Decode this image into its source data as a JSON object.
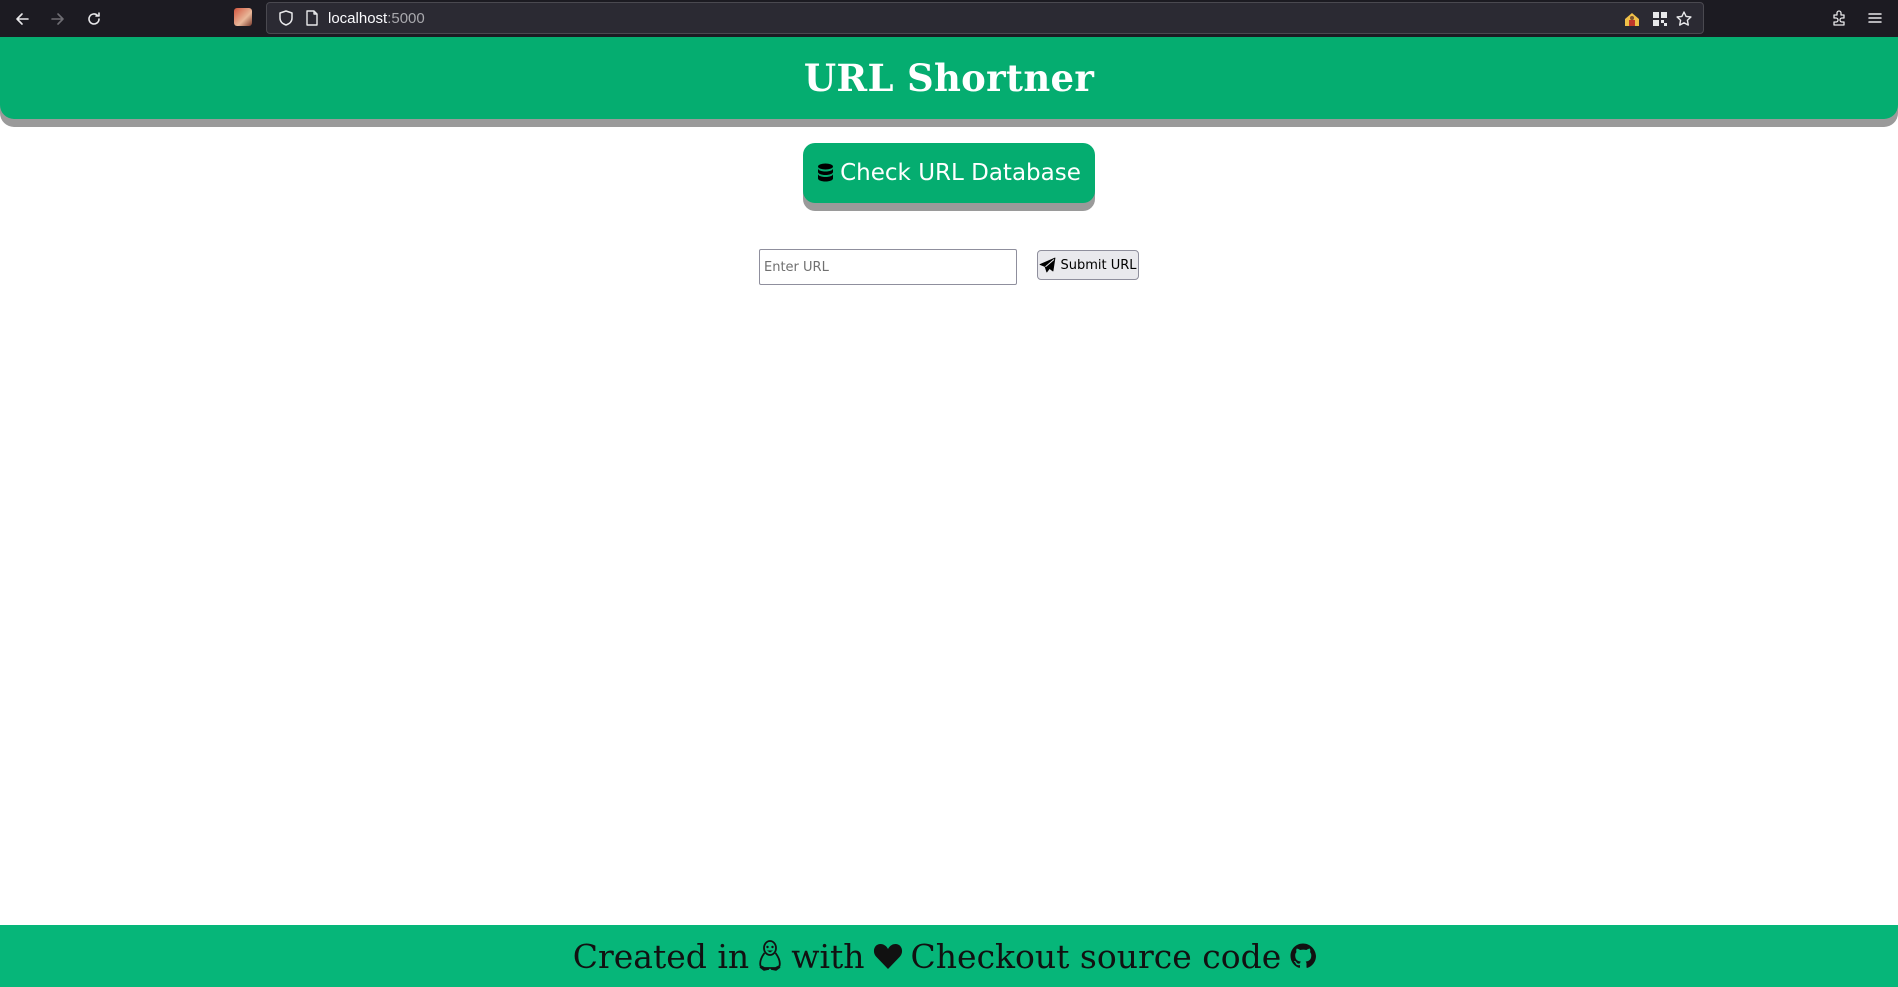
{
  "browser": {
    "url_host": "localhost",
    "url_port": ":5000",
    "icons": [
      "back-icon",
      "forward-icon",
      "reload-icon",
      "shield-icon",
      "page-icon",
      "extension-icon",
      "qr-icon",
      "bookmark-star-icon",
      "extensions-icon",
      "menu-icon"
    ]
  },
  "header": {
    "title": "URL Shortner",
    "background_color": "#05ad70"
  },
  "actions": {
    "db_button_label": "Check URL Database",
    "db_button_icon": "database-icon"
  },
  "form": {
    "url_placeholder": "Enter URL",
    "url_value": "",
    "submit_label": "Submit URL",
    "submit_icon": "paper-plane-icon"
  },
  "footer": {
    "created_in_text": "Created in",
    "created_in_icon": "linux-icon",
    "with_text": "with",
    "with_icon": "heart-icon",
    "source_text": "Checkout source code",
    "source_icon": "github-icon",
    "background_color": "#06b679"
  }
}
